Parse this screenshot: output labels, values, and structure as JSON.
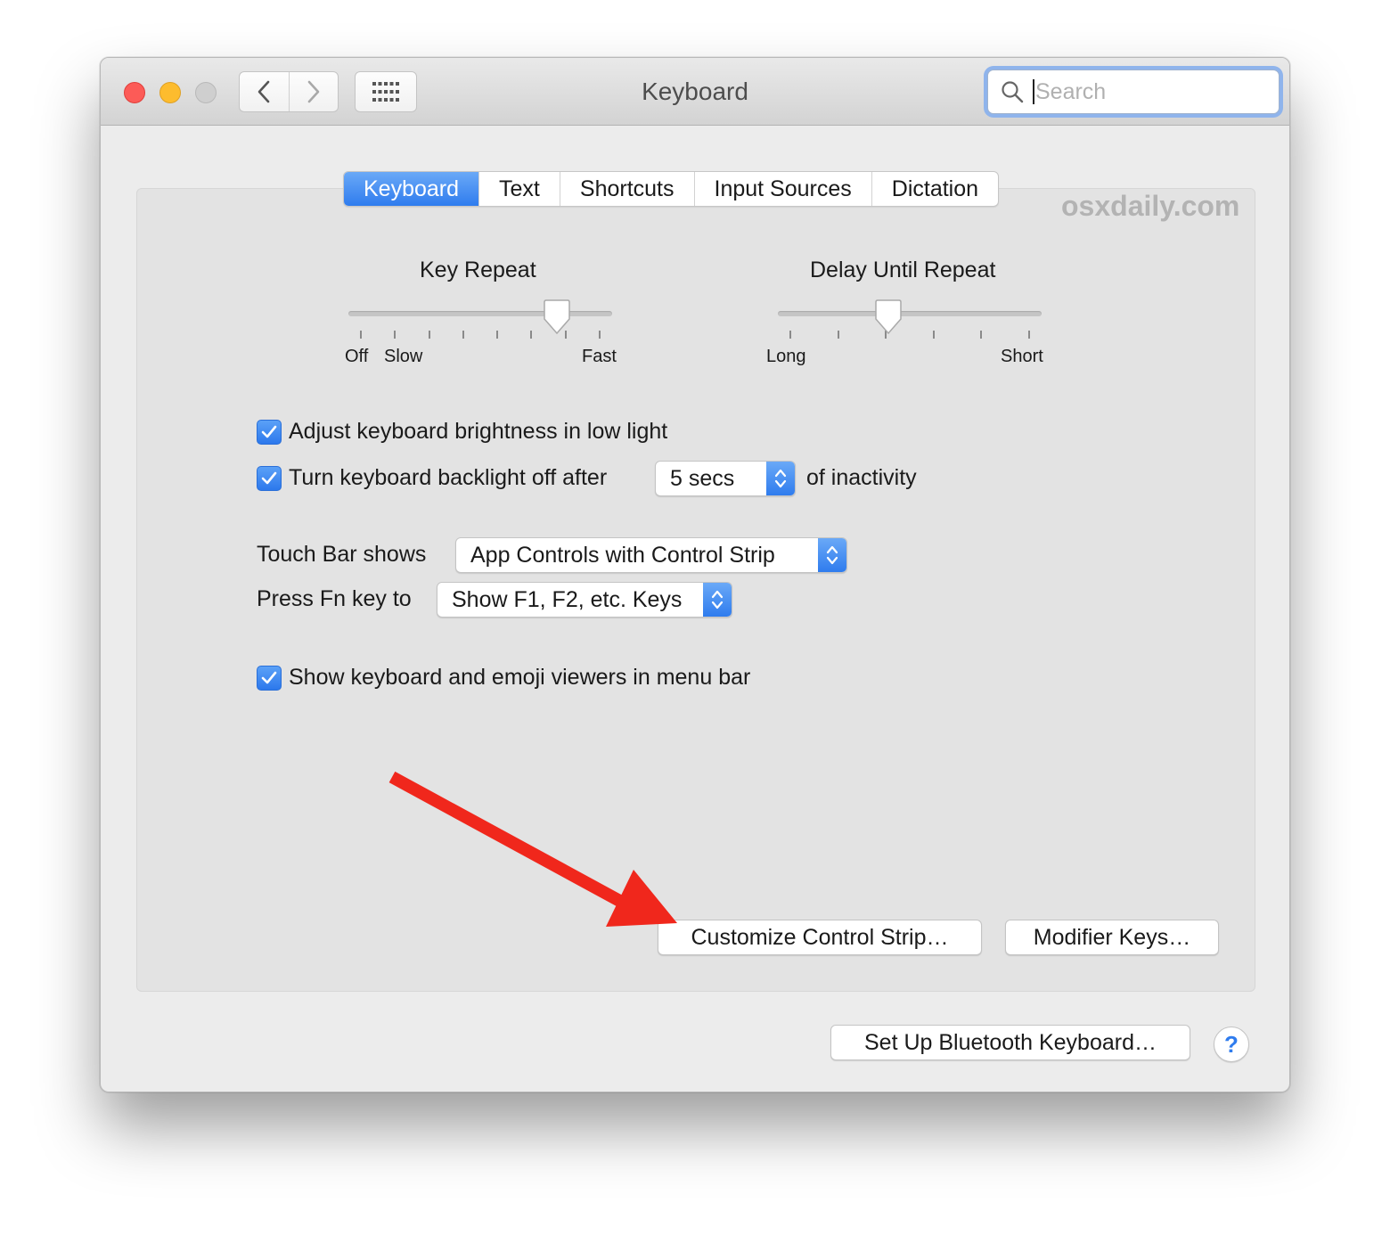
{
  "window": {
    "title": "Keyboard",
    "search_placeholder": "Search"
  },
  "tabs": [
    {
      "label": "Keyboard",
      "active": true
    },
    {
      "label": "Text",
      "active": false
    },
    {
      "label": "Shortcuts",
      "active": false
    },
    {
      "label": "Input Sources",
      "active": false
    },
    {
      "label": "Dictation",
      "active": false
    }
  ],
  "watermark": "osxdaily.com",
  "key_repeat": {
    "title": "Key Repeat",
    "label_off": "Off",
    "label_slow": "Slow",
    "label_fast": "Fast",
    "ticks": 8,
    "value_fraction": 0.82
  },
  "delay_until_repeat": {
    "title": "Delay Until Repeat",
    "label_long": "Long",
    "label_short": "Short",
    "ticks": 6,
    "value_fraction": 0.41
  },
  "options": {
    "adjust_brightness": {
      "label": "Adjust keyboard brightness in low light",
      "checked": true
    },
    "backlight_off": {
      "label": "Turn keyboard backlight off after",
      "checked": true,
      "value": "5 secs",
      "suffix": "of inactivity"
    },
    "touch_bar": {
      "label": "Touch Bar shows",
      "value": "App Controls with Control Strip"
    },
    "fn_key": {
      "label": "Press Fn key to",
      "value": "Show F1, F2, etc. Keys"
    },
    "show_viewers": {
      "label": "Show keyboard and emoji viewers in menu bar",
      "checked": true
    }
  },
  "buttons": {
    "customize_control_strip": "Customize Control Strip…",
    "modifier_keys": "Modifier Keys…",
    "bluetooth_keyboard": "Set Up Bluetooth Keyboard…",
    "help": "?"
  },
  "colors": {
    "accent": "#2f7cee",
    "arrow": "#f0271c"
  }
}
